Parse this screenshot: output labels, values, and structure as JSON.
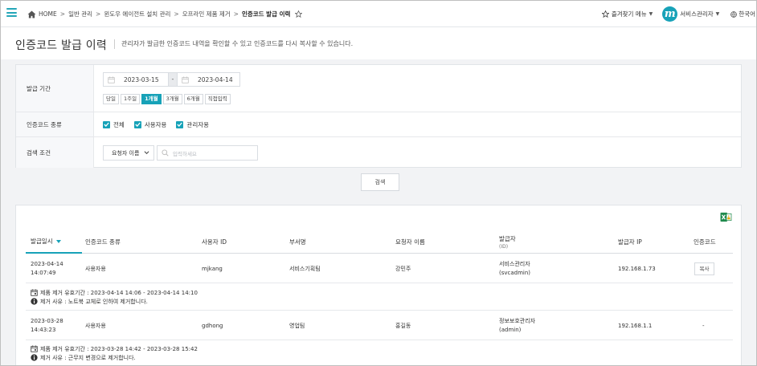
{
  "breadcrumb": {
    "home": "HOME",
    "items": [
      "일반 관리",
      "윈도우 에이전트 설치 관리",
      "오프라인 제품 제거"
    ],
    "current": "인증코드 발급 이력"
  },
  "topright": {
    "favorites": "즐겨찾기 메뉴",
    "user": "서비스관리자",
    "language": "한국어"
  },
  "page": {
    "title": "인증코드 발급 이력",
    "description": "관리자가 발급한 인증코드 내역을 확인할 수 있고 인증코드를 다시 복사할 수 있습니다."
  },
  "filter": {
    "period_label": "발급 기간",
    "start_date": "2023-03-15",
    "date_dash": "-",
    "end_date": "2023-04-14",
    "period_buttons": [
      "당일",
      "1주일",
      "1개월",
      "3개월",
      "6개월",
      "직접입력"
    ],
    "period_active": "1개월",
    "type_label": "인증코드 종류",
    "type_options": [
      "전체",
      "사용자용",
      "관리자용"
    ],
    "search_label": "검색 조건",
    "search_select": "요청자 이름",
    "search_placeholder": "입력하세요",
    "search_button": "검색"
  },
  "table": {
    "headers": {
      "date": "발급일시",
      "type": "인증코드 종류",
      "user_id": "사용자 ID",
      "dept": "부서명",
      "requester": "요청자 이름",
      "issuer": "발급자",
      "issuer_sub": "(ID)",
      "issuer_ip": "발급자 IP",
      "code": "인증코드"
    },
    "rows": [
      {
        "date": "2023-04-14",
        "time": "14:07:49",
        "type": "사용자용",
        "user_id": "mjkang",
        "dept": "서비스기획팀",
        "requester": "강민주",
        "issuer": "서비스관리자",
        "issuer_id": "(svcadmin)",
        "ip": "192.168.1.73",
        "code": "복사",
        "period": "제품 제거 유효기간 : 2023-04-14 14:06 - 2023-04-14 14:10",
        "reason": "제거 사유 : 노트북 교체로 인하여 제거합니다."
      },
      {
        "date": "2023-03-28",
        "time": "14:43:23",
        "type": "사용자용",
        "user_id": "gdhong",
        "dept": "영업팀",
        "requester": "홍길동",
        "issuer": "정보보호관리자",
        "issuer_id": "(admin)",
        "ip": "192.168.1.1",
        "code": "-",
        "period": "제품 제거 유효기간 : 2023-03-28 14:42 - 2023-03-28 15:42",
        "reason": "제거 사유 : 근무지 변경으로 제거합니다."
      }
    ]
  },
  "colors": {
    "accent": "#17a2b8",
    "background": "#f2f3f5"
  }
}
